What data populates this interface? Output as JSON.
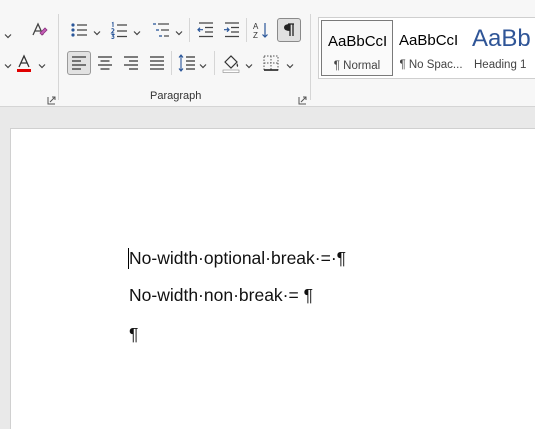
{
  "ribbon": {
    "paragraph_group_label": "Paragraph",
    "styles": [
      {
        "preview": "AaBbCcI",
        "name": "¶ Normal",
        "selected": true
      },
      {
        "preview": "AaBbCcI",
        "name": "¶ No Spac...",
        "selected": false
      },
      {
        "preview": "AaBb",
        "name": "Heading 1",
        "selected": false
      }
    ],
    "font_color_accent": "#e00000",
    "heading_color": "#2f5597"
  },
  "document": {
    "paragraphs": [
      "No-width·optional·break·=·¶",
      "No-width·non·break·= ¶",
      "¶"
    ]
  }
}
